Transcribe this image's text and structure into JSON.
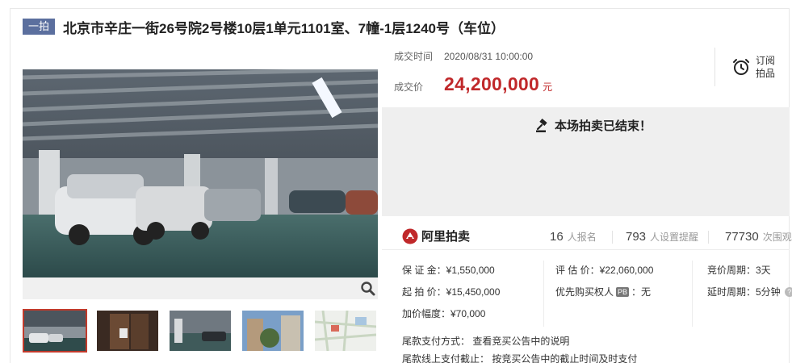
{
  "header": {
    "round_badge": "一拍",
    "title": "北京市辛庄一街26号院2号楼10层1单元1101室、7幢-1层1240号（车位）"
  },
  "deal": {
    "time_label": "成交时间",
    "time_value": "2020/08/31 10:00:00",
    "price_label": "成交价",
    "price_value": "24,200,000",
    "price_unit": "元"
  },
  "subscribe": {
    "line1": "订阅",
    "line2": "拍品",
    "icon": "alarm-clock-icon"
  },
  "status": {
    "ended_text": "本场拍卖已结束！",
    "icon": "gavel-icon"
  },
  "stats": {
    "brand": "阿里拍卖",
    "signup_count": "16",
    "signup_label": "人报名",
    "remind_count": "793",
    "remind_label": "人设置提醒",
    "view_count": "77730",
    "view_label": "次围观"
  },
  "details": {
    "deposit": "保 证 金：¥1,550,000",
    "start_price": "起 拍 价：¥15,450,000",
    "increment": "加价幅度：¥70,000",
    "appraisal": "评 估 价：¥22,060,000",
    "priority_prefix": "优先购买权人",
    "priority_badge": "PB",
    "priority_suffix": "：无",
    "bid_cycle": "竞价周期：3天",
    "delay_cycle": "延时周期：5分钟",
    "help_icon_text": "?",
    "payment_method": "尾款支付方式：  查看竞买公告中的说明",
    "payment_deadline": "尾款线上支付截止：  按竞买公告中的截止时间及时支付"
  },
  "colors": {
    "accent_red": "#c0282a",
    "badge_blue": "#5b6f9e",
    "thumb_active": "#c23a2b"
  }
}
